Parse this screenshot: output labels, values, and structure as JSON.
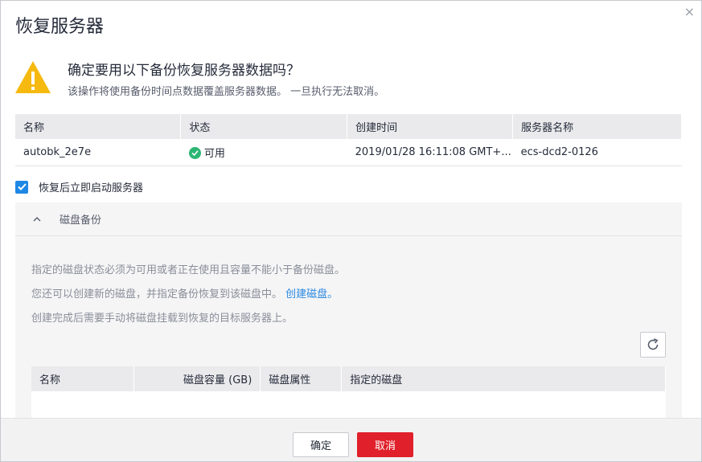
{
  "dialog": {
    "title": "恢复服务器",
    "close_glyph": "×",
    "confirm_question": "确定要用以下备份恢复服务器数据吗？",
    "confirm_subtext": "该操作将使用备份时间点数据覆盖服务器数据。 一旦执行无法取消。"
  },
  "backup_table": {
    "headers": [
      "名称",
      "状态",
      "创建时间",
      "服务器名称"
    ],
    "row": {
      "name": "autobk_2e7e",
      "status": "可用",
      "created": "2019/01/28 16:11:08 GMT+...",
      "server": "ecs-dcd2-0126"
    }
  },
  "start_after_restore": {
    "checked": true,
    "label": "恢复后立即启动服务器"
  },
  "disk_backup": {
    "title": "磁盘备份",
    "expanded": true,
    "note1": "指定的磁盘状态必须为可用或者正在使用且容量不能小于备份磁盘。",
    "note2_prefix": "您还可以创建新的磁盘，并指定备份恢复到该磁盘中。",
    "note2_link": "创建磁盘。",
    "note3": "创建完成后需要手动将磁盘挂载到恢复的目标服务器上。",
    "table_headers": [
      "名称",
      "磁盘容量 (GB)",
      "磁盘属性",
      "指定的磁盘"
    ]
  },
  "footer": {
    "ok_label": "确定",
    "cancel_label": "取消"
  },
  "colors": {
    "accent": "#1e88e5",
    "danger": "#e0202a",
    "success": "#2bb673",
    "warning": "#f5b90f",
    "link": "#2a88e0"
  },
  "icons": [
    "close-icon",
    "warning-icon",
    "check-circle-icon",
    "checkbox-check-icon",
    "chevron-up-icon",
    "refresh-icon"
  ]
}
